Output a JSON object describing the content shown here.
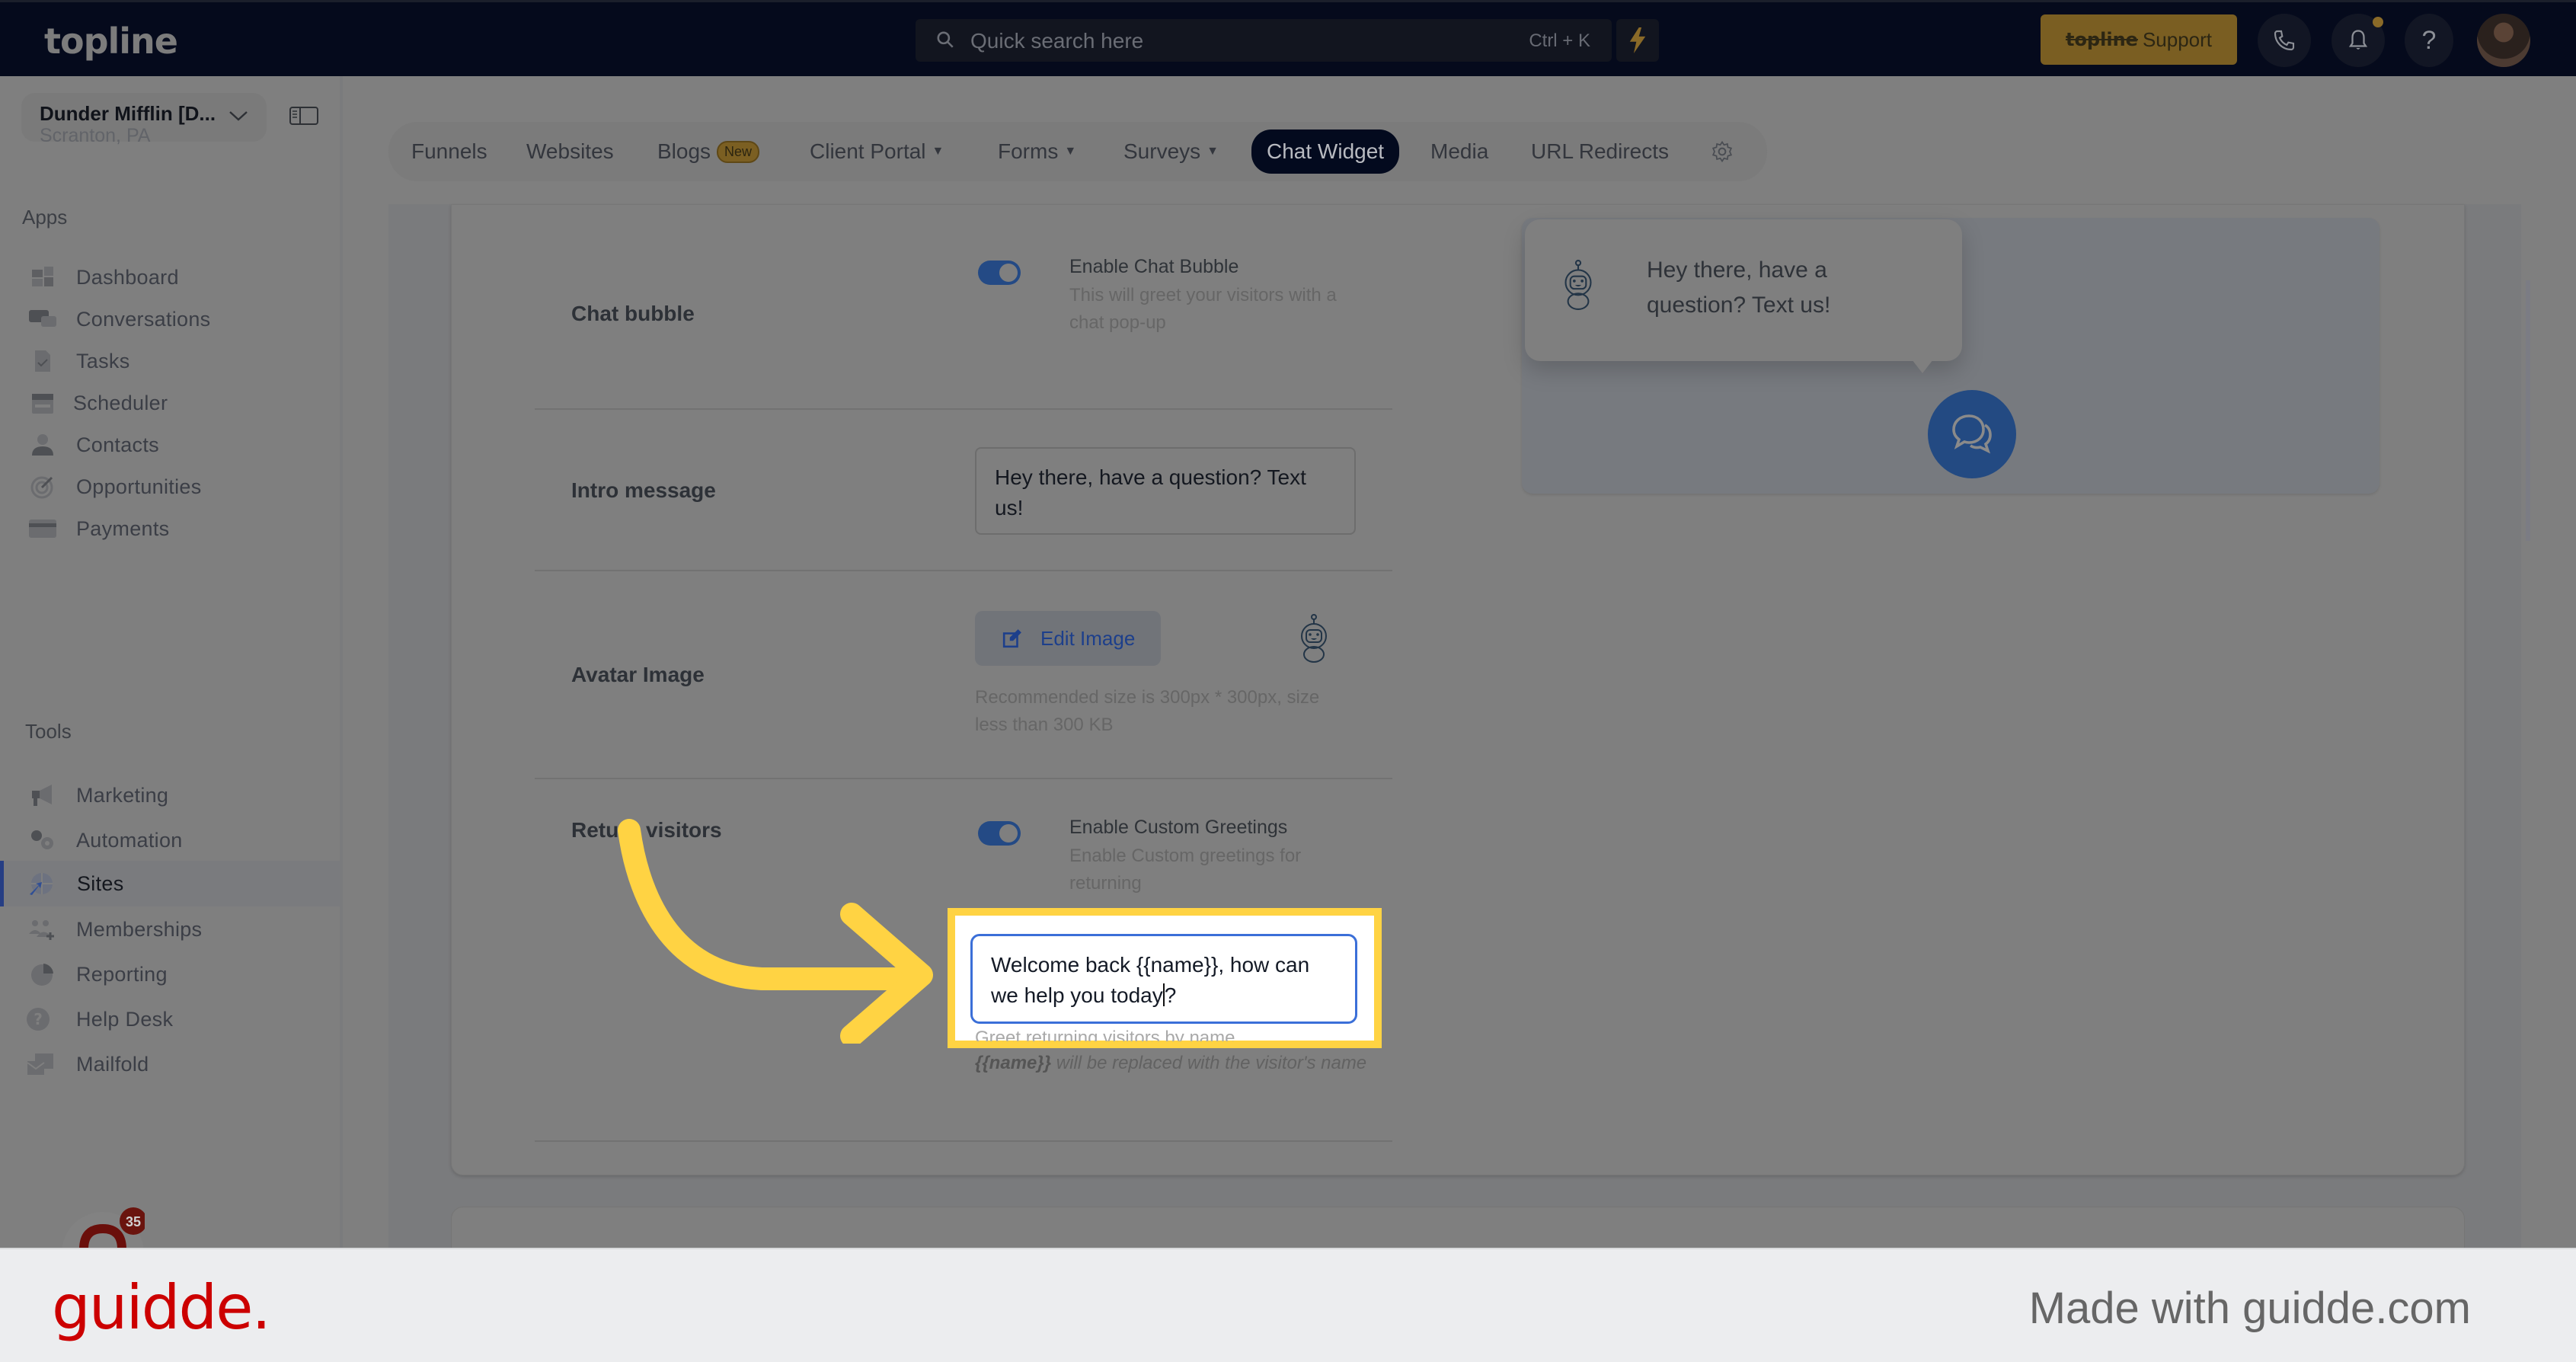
{
  "header": {
    "logo": "topline",
    "search_placeholder": "Quick search here",
    "search_shortcut": "Ctrl + K",
    "support_brand": "topline",
    "support_label": "Support",
    "icons": [
      "search-icon",
      "bolt-icon",
      "phone-icon",
      "bell-icon",
      "help-icon",
      "user-avatar"
    ]
  },
  "sidebar": {
    "location_name": "Dunder Mifflin [D...",
    "location_city": "Scranton, PA",
    "apps_label": "Apps",
    "tools_label": "Tools",
    "apps": [
      {
        "label": "Dashboard",
        "icon": "dashboard-icon"
      },
      {
        "label": "Conversations",
        "icon": "conversations-icon"
      },
      {
        "label": "Tasks",
        "icon": "tasks-icon"
      },
      {
        "label": "Scheduler",
        "icon": "calendar-icon"
      },
      {
        "label": "Contacts",
        "icon": "contacts-icon"
      },
      {
        "label": "Opportunities",
        "icon": "target-icon"
      },
      {
        "label": "Payments",
        "icon": "card-icon"
      }
    ],
    "tools": [
      {
        "label": "Marketing",
        "icon": "megaphone-icon"
      },
      {
        "label": "Automation",
        "icon": "gears-icon"
      },
      {
        "label": "Sites",
        "icon": "globe-icon",
        "active": true
      },
      {
        "label": "Memberships",
        "icon": "memberships-icon"
      },
      {
        "label": "Reporting",
        "icon": "pie-chart-icon"
      },
      {
        "label": "Help Desk",
        "icon": "help-circle-icon"
      },
      {
        "label": "Mailfold",
        "icon": "mail-icon"
      }
    ],
    "chat_badge_count": "35"
  },
  "tabs": [
    {
      "label": "Funnels"
    },
    {
      "label": "Websites"
    },
    {
      "label": "Blogs",
      "badge": "New"
    },
    {
      "label": "Client Portal",
      "dropdown": true
    },
    {
      "label": "Forms",
      "dropdown": true
    },
    {
      "label": "Surveys",
      "dropdown": true
    },
    {
      "label": "Chat Widget",
      "active": true
    },
    {
      "label": "Media"
    },
    {
      "label": "URL Redirects"
    }
  ],
  "settings": {
    "chat_bubble": {
      "label": "Chat bubble",
      "toggle_on": true,
      "title": "Enable Chat Bubble",
      "desc": "This will greet your visitors with a chat pop-up"
    },
    "intro_message": {
      "label": "Intro message",
      "value": "Hey there, have a question? Text us!"
    },
    "avatar_image": {
      "label": "Avatar Image",
      "button": "Edit Image",
      "hint": "Recommended size is 300px * 300px, size less than 300 KB"
    },
    "return_visitors": {
      "label": "Return visitors",
      "toggle_on": true,
      "title": "Enable Custom Greetings",
      "desc": "Enable Custom greetings for returning",
      "value_before_cursor": "Welcome back {{name}}, how can we help you today",
      "value_after_cursor": "?",
      "hint": "Greet returning visitors by name",
      "note_token": "{{name}}",
      "note_text": " will be replaced with the visitor's name"
    }
  },
  "preview": {
    "bubble_text": "Hey there, have a question? Text us!"
  },
  "footer": {
    "brand": "guidde.",
    "tagline": "Made with guidde.com"
  },
  "colors": {
    "accent_blue": "#234a82",
    "highlight_yellow": "#ffd343",
    "brand_red": "#cc0000",
    "header_bg": "#050a1c"
  }
}
